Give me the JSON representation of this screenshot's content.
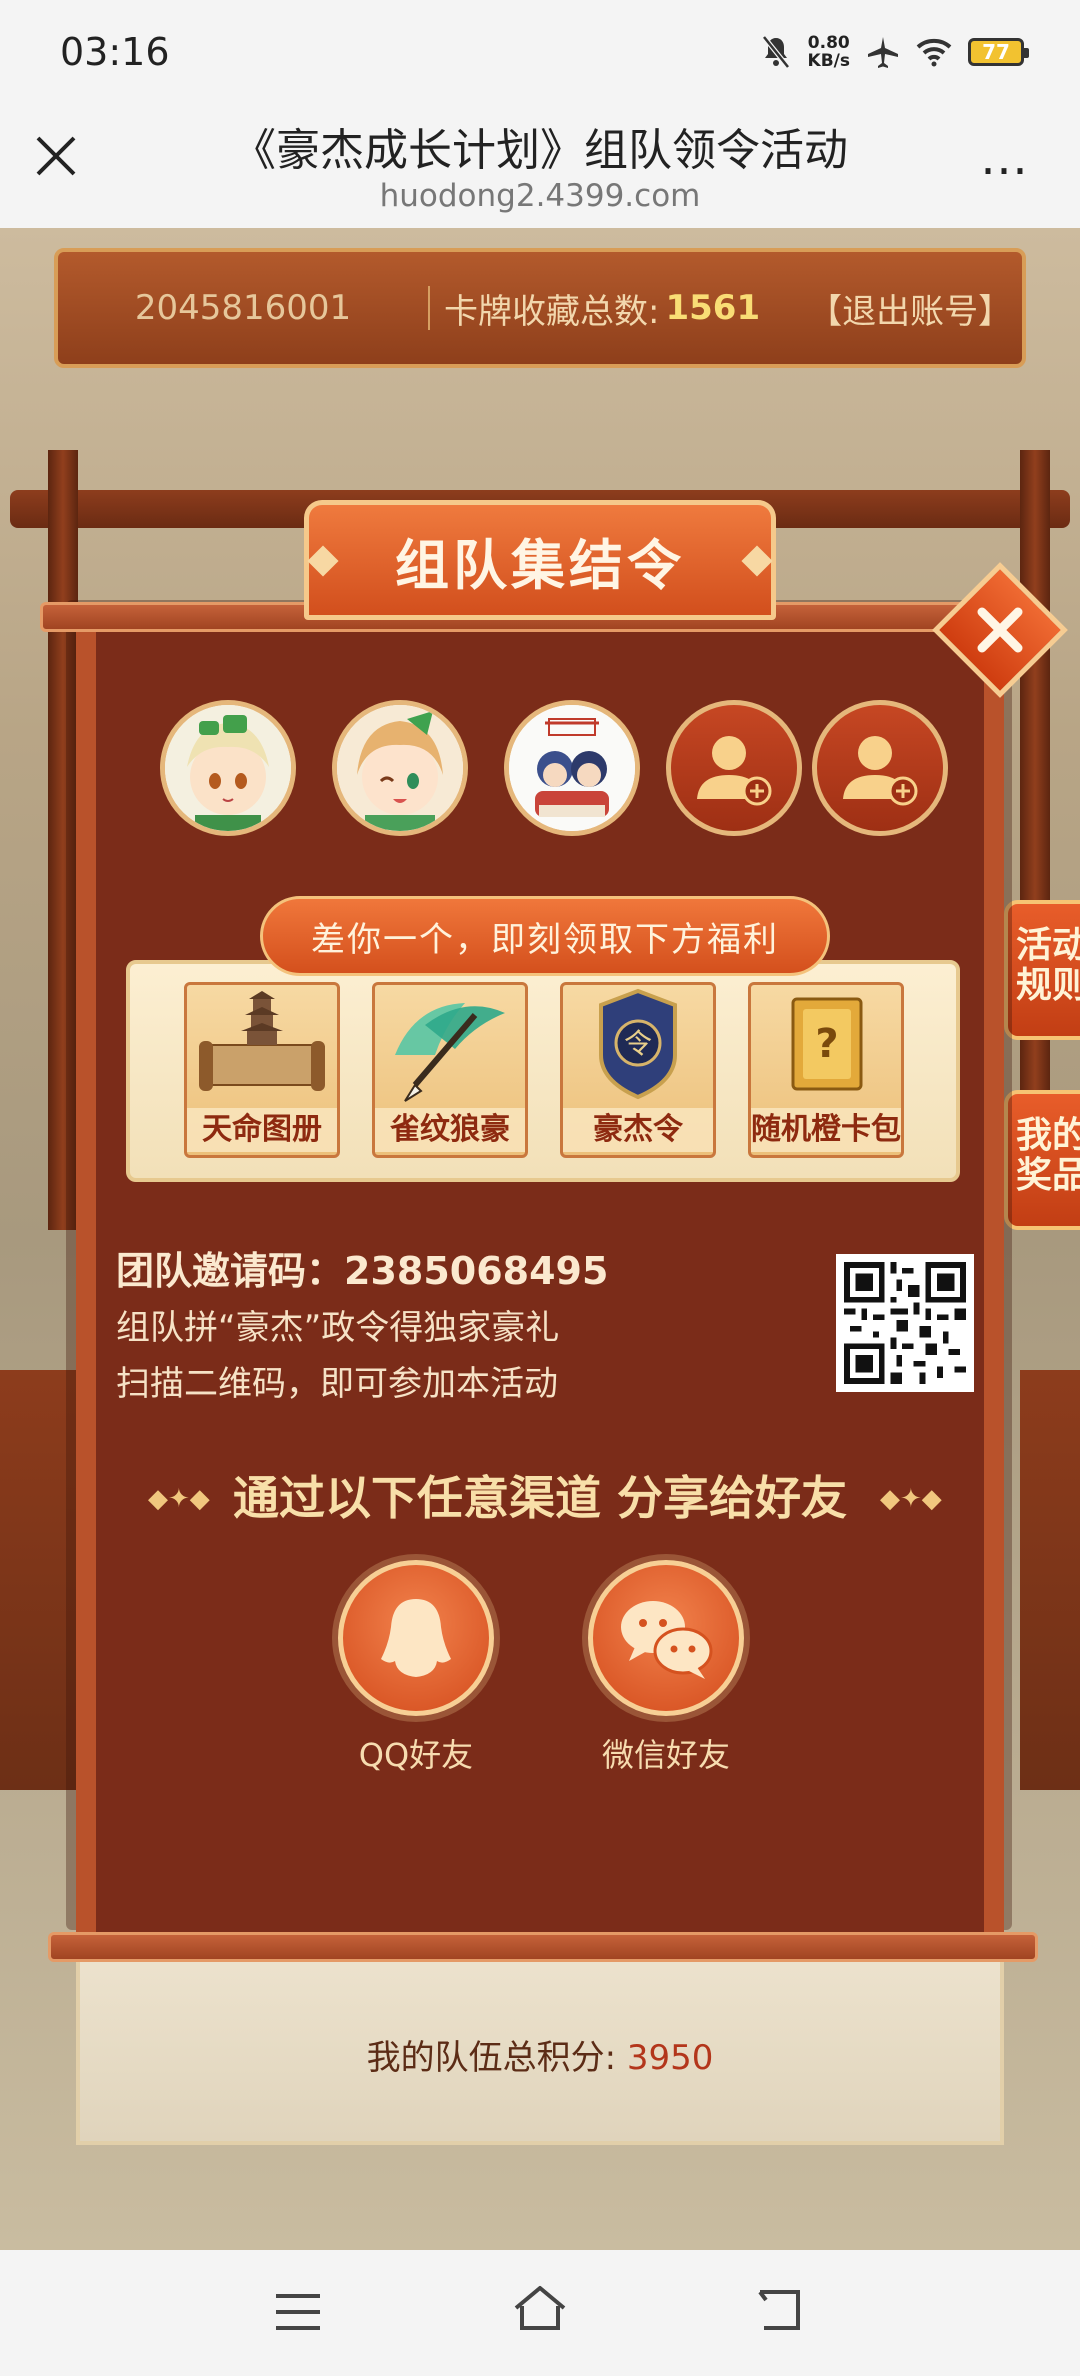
{
  "status_bar": {
    "time": "03:16",
    "net_speed_value": "0.80",
    "net_speed_unit": "KB/s",
    "battery": "77"
  },
  "browser": {
    "title": "《豪杰成长计划》组队领令活动",
    "url": "huodong2.4399.com",
    "more_label": "⋯"
  },
  "account": {
    "id": "2045816001",
    "count_label": "卡牌收藏总数:",
    "count_value": "1561",
    "logout": "【退出账号】"
  },
  "side_tabs": [
    {
      "label": "活动\n规则"
    },
    {
      "label": "我的\n奖品"
    }
  ],
  "modal": {
    "title": "组队集结令",
    "reward_banner": "差你一个，即刻领取下方福利",
    "rewards": [
      {
        "label": "天命图册"
      },
      {
        "label": "雀纹狼豪"
      },
      {
        "label": "豪杰令"
      },
      {
        "label": "随机橙卡包"
      }
    ],
    "invite_code_label": "团队邀请码：",
    "invite_code": "2385068495",
    "invite_line2": "组队拼“豪杰”政令得独家豪礼",
    "invite_line3": "扫描二维码，即可参加本活动",
    "share_title": "通过以下任意渠道 分享给好友",
    "share_buttons": [
      {
        "label": "QQ好友"
      },
      {
        "label": "微信好友"
      }
    ]
  },
  "team": {
    "score_label": "我的队伍总积分:",
    "score_value": "3950"
  },
  "colors": {
    "modal_bg": "#7b2c19",
    "accent_orange": "#e0612a",
    "gold": "#f9dd75"
  }
}
